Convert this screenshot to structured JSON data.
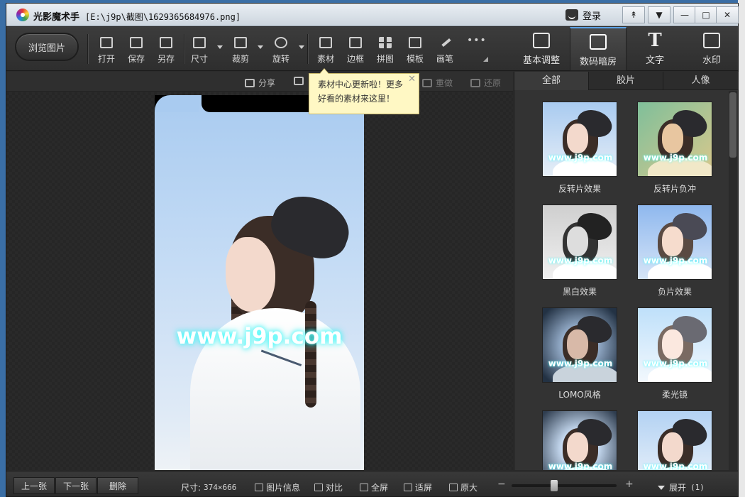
{
  "window": {
    "app_name": "光影魔术手",
    "file_path": "[E:\\j9p\\截图\\1629365684976.png]"
  },
  "titlebar": {
    "login_label": "登录",
    "buttons": [
      "↟",
      "▼",
      "—",
      "□",
      "✕"
    ]
  },
  "toolbar": {
    "browse_label": "浏览图片",
    "tools": [
      {
        "label": "打开",
        "icon": "open-icon"
      },
      {
        "label": "保存",
        "icon": "save-icon"
      },
      {
        "label": "另存",
        "icon": "save-as-icon"
      },
      {
        "label": "尺寸",
        "icon": "resize-icon"
      },
      {
        "label": "裁剪",
        "icon": "crop-icon"
      },
      {
        "label": "旋转",
        "icon": "rotate-icon"
      },
      {
        "label": "素材",
        "icon": "material-icon"
      },
      {
        "label": "边框",
        "icon": "border-icon"
      },
      {
        "label": "拼图",
        "icon": "collage-icon"
      },
      {
        "label": "模板",
        "icon": "template-icon"
      },
      {
        "label": "画笔",
        "icon": "brush-icon"
      },
      {
        "label": "",
        "icon": "more-icon"
      }
    ],
    "right_tabs": [
      {
        "label": "基本调整",
        "icon": "basic-adjust-icon"
      },
      {
        "label": "数码暗房",
        "icon": "darkroom-icon"
      },
      {
        "label": "文字",
        "icon": "text-icon",
        "glyph": "T"
      },
      {
        "label": "水印",
        "icon": "watermark-icon"
      }
    ],
    "active_right_tab": "数码暗房"
  },
  "subbar": {
    "share": "分享",
    "redo": "重做",
    "undo": "还原"
  },
  "tooltip": {
    "line1": "素材中心更新啦！更多",
    "line2": "好看的素材来这里！",
    "close": "✕"
  },
  "canvas": {
    "watermark_text": "www.j9p.com"
  },
  "effects_panel": {
    "tabs": [
      "全部",
      "胶片",
      "人像"
    ],
    "active_tab": "全部",
    "thumb_watermark": "www.j9p.com",
    "effects": [
      {
        "name": "反转片效果"
      },
      {
        "name": "反转片负冲"
      },
      {
        "name": "黑白效果"
      },
      {
        "name": "负片效果"
      },
      {
        "name": "LOMO风格"
      },
      {
        "name": "柔光镜"
      },
      {
        "name": ""
      },
      {
        "name": ""
      }
    ]
  },
  "statusbar": {
    "prev": "上一张",
    "next": "下一张",
    "delete": "删除",
    "size_label": "尺寸:",
    "size_value": "374×666",
    "info": "图片信息",
    "compare": "对比",
    "fullscreen": "全屏",
    "fit": "适屏",
    "original": "原大",
    "zoom_minus": "−",
    "zoom_plus": "+",
    "zoom_level": 0.4,
    "expand_label": "展开",
    "expand_count": "(1)"
  },
  "colors": {
    "accent": "#5aa1e6",
    "tooltip_bg": "#fff8c4",
    "panel_bg": "#333333"
  }
}
